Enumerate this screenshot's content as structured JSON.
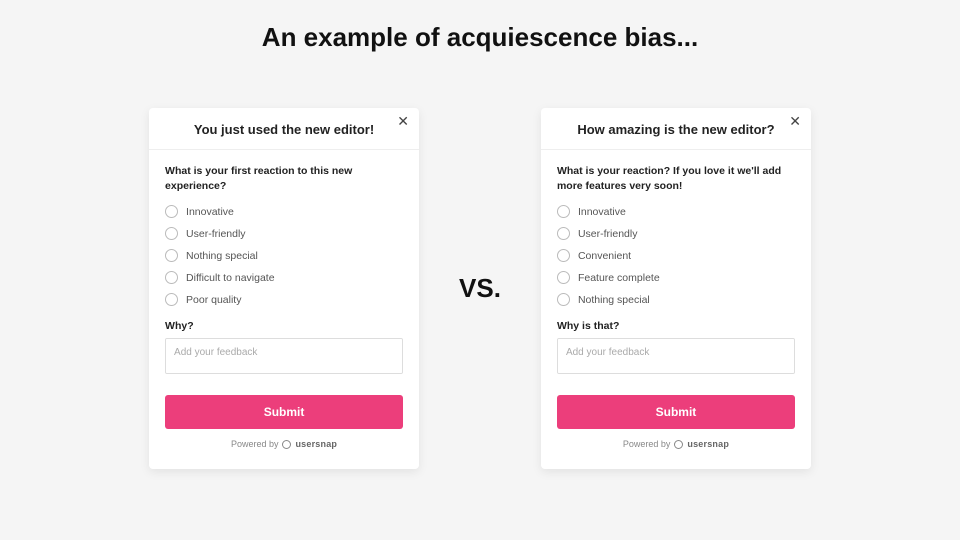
{
  "page": {
    "title": "An example of acquiescence bias...",
    "vs_label": "VS."
  },
  "cards": {
    "left": {
      "title": "You just used the new editor!",
      "close_glyph": "✕",
      "question": "What is your first reaction to this new experience?",
      "options": [
        "Innovative",
        "User-friendly",
        "Nothing special",
        "Difficult to navigate",
        "Poor quality"
      ],
      "why_label": "Why?",
      "feedback_placeholder": "Add your feedback",
      "submit_label": "Submit",
      "powered_prefix": "Powered by",
      "powered_brand": "usersnap"
    },
    "right": {
      "title": "How amazing is the new editor?",
      "close_glyph": "✕",
      "question": "What is your reaction? If you love it we'll add more features very soon!",
      "options": [
        "Innovative",
        "User-friendly",
        "Convenient",
        "Feature complete",
        "Nothing special"
      ],
      "why_label": "Why is that?",
      "feedback_placeholder": "Add your feedback",
      "submit_label": "Submit",
      "powered_prefix": "Powered by",
      "powered_brand": "usersnap"
    }
  },
  "colors": {
    "accent": "#ec3e7b",
    "bg": "#f5f5f5"
  }
}
